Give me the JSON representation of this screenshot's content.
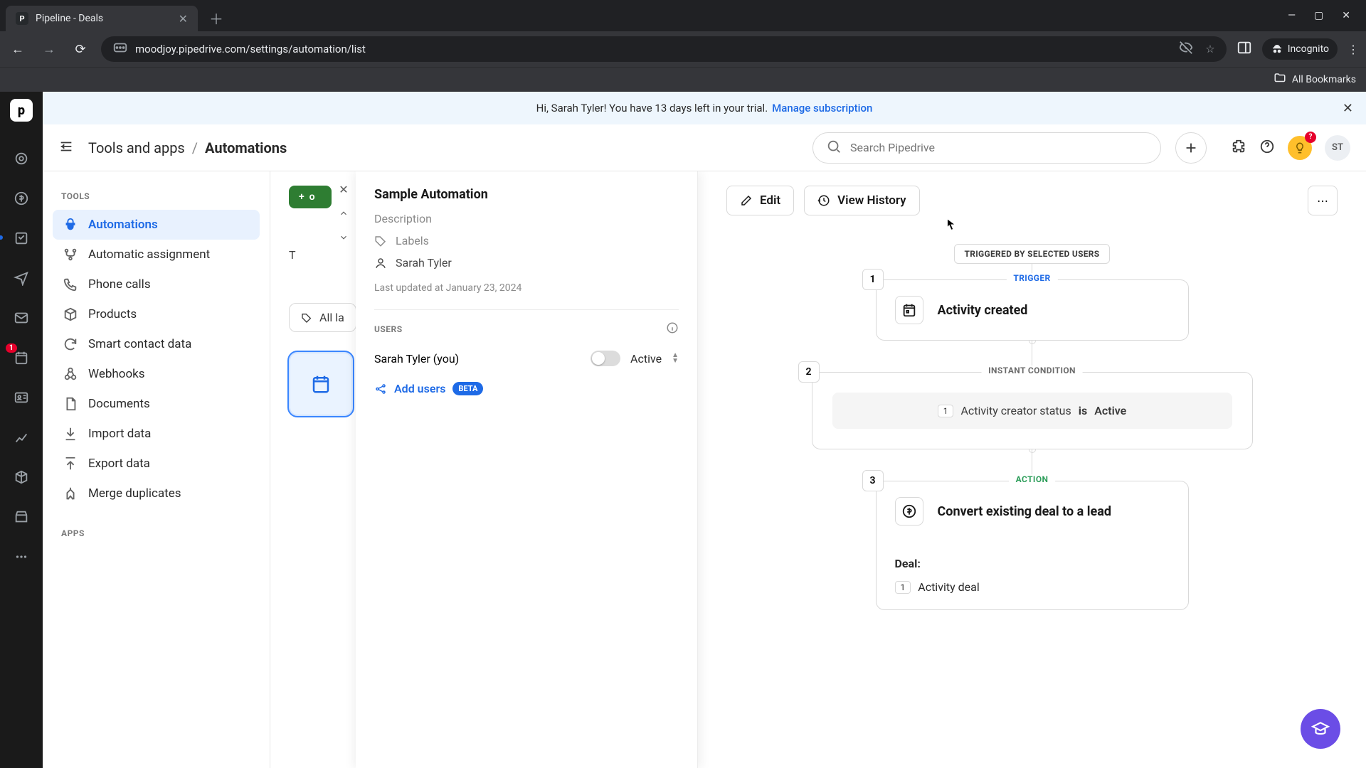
{
  "browser": {
    "tab_title": "Pipeline - Deals",
    "url": "moodjoy.pipedrive.com/settings/automation/list",
    "incognito_label": "Incognito",
    "all_bookmarks": "All Bookmarks"
  },
  "banner": {
    "greeting": "Hi, Sarah Tyler! You have 13 days left in your trial.",
    "link": "Manage subscription"
  },
  "header": {
    "crumb_root": "Tools and apps",
    "crumb_current": "Automations",
    "search_placeholder": "Search Pipedrive",
    "avatar_initials": "ST"
  },
  "rail": {
    "notif_count": "1",
    "tip_badge": "?"
  },
  "sidebar": {
    "section_tools": "TOOLS",
    "section_apps": "APPS",
    "items": [
      "Automations",
      "Automatic assignment",
      "Phone calls",
      "Products",
      "Smart contact data",
      "Webhooks",
      "Documents",
      "Import data",
      "Export data",
      "Merge duplicates"
    ]
  },
  "behind": {
    "all_labels": "All la",
    "t_row": "T"
  },
  "panel": {
    "title": "Sample Automation",
    "description_label": "Description",
    "labels_label": "Labels",
    "owner": "Sarah Tyler",
    "updated": "Last updated at January 23, 2024",
    "users_heading": "USERS",
    "user_row_name": "Sarah Tyler (you)",
    "active_label": "Active",
    "add_users": "Add users",
    "beta": "BETA"
  },
  "canvas": {
    "edit": "Edit",
    "view_history": "View History",
    "triggered_pill": "TRIGGERED BY SELECTED USERS",
    "trigger_label": "TRIGGER",
    "trigger_title": "Activity created",
    "cond_label": "INSTANT CONDITION",
    "cond_field": "Activity creator status",
    "cond_op": "is",
    "cond_value": "Active",
    "action_label": "ACTION",
    "action_title": "Convert existing deal to a lead",
    "action_k1": "Deal:",
    "action_v1": "Activity deal",
    "step1": "1",
    "step2": "2",
    "step3": "3",
    "ref1": "1"
  }
}
